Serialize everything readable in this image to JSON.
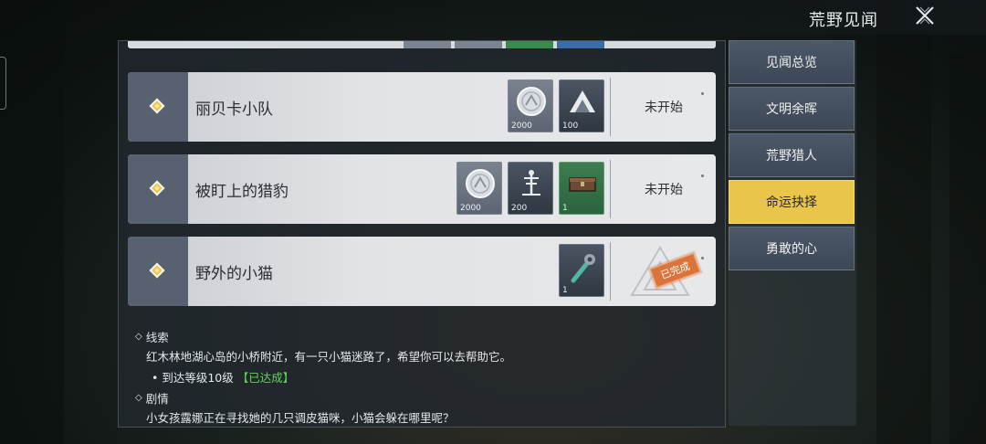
{
  "header": {
    "title": "荒野见闻"
  },
  "quests": [
    {
      "title": "丽贝卡小队",
      "rewards": [
        {
          "icon": "silver-coin-icon",
          "qty": "2000",
          "style": "gray"
        },
        {
          "icon": "mountain-icon",
          "qty": "100",
          "style": "dark"
        }
      ],
      "status": "未开始"
    },
    {
      "title": "被盯上的猎豹",
      "rewards": [
        {
          "icon": "silver-coin-icon",
          "qty": "2000",
          "style": "gray"
        },
        {
          "icon": "antenna-icon",
          "qty": "200",
          "style": "dark"
        },
        {
          "icon": "chest-icon",
          "qty": "1",
          "style": "green"
        }
      ],
      "status": "未开始"
    },
    {
      "title": "野外的小猫",
      "rewards": [
        {
          "icon": "wrench-icon",
          "qty": "1",
          "style": "dark"
        }
      ],
      "status": "已完成"
    }
  ],
  "details": {
    "clue_heading": "线索",
    "clue_text": "红木林地湖心岛的小桥附近，有一只小猫迷路了，希望你可以去帮助它。",
    "requirement": "到达等级10级",
    "requirement_state": "【已达成】",
    "story_heading": "剧情",
    "story_text": "小女孩露娜正在寻找她的几只调皮猫咪，小猫会躲在哪里呢？"
  },
  "sidebar": {
    "items": [
      {
        "label": "见闻总览"
      },
      {
        "label": "文明余晖"
      },
      {
        "label": "荒野猎人"
      },
      {
        "label": "命运抉择"
      },
      {
        "label": "勇敢的心"
      }
    ],
    "active_index": 3
  },
  "colors": {
    "accent": "#e9c54a",
    "complete_stamp": "#d9743c",
    "done_text": "#63d35f"
  }
}
